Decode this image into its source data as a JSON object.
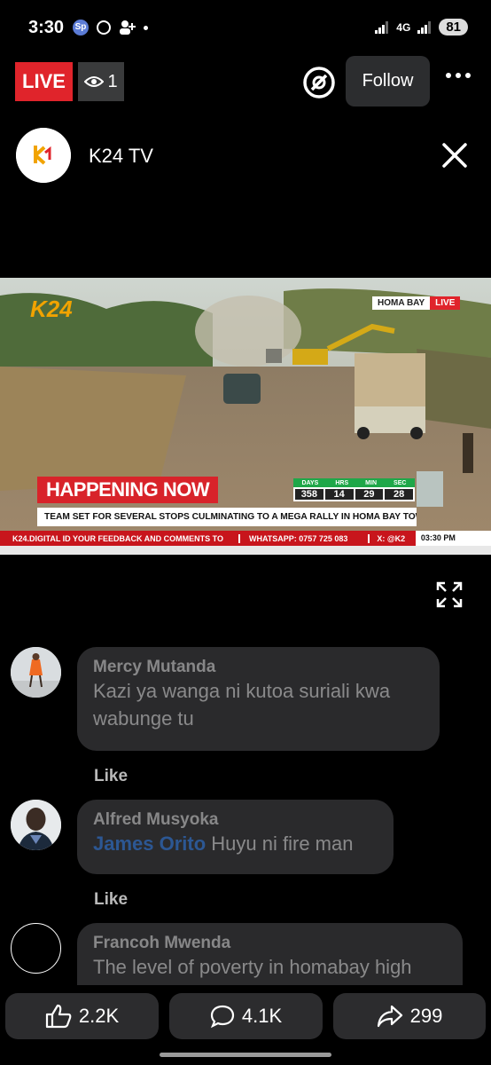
{
  "status_bar": {
    "time": "3:30",
    "network": "4G",
    "battery": "81"
  },
  "top_bar": {
    "live_label": "LIVE",
    "viewer_count": "1",
    "follow_label": "Follow"
  },
  "page": {
    "name": "K24 TV"
  },
  "video": {
    "channel_logo": "K24",
    "location": "HOMA BAY",
    "location_live": "LIVE",
    "headline": "HAPPENING NOW",
    "subheadline": "TEAM SET FOR SEVERAL STOPS CULMINATING TO A MEGA RALLY IN HOMA BAY TOWN",
    "countdown": {
      "labels": [
        "DAYS",
        "HRS",
        "MIN",
        "SEC"
      ],
      "values": [
        "358",
        "14",
        "29",
        "28"
      ]
    },
    "ticker": "K24.DIGITAL  ID YOUR FEEDBACK AND COMMENTS TO",
    "ticker_whatsapp": "WHATSAPP: 0757 725 083",
    "ticker_x": "X: @K2",
    "clock": "03:30 PM"
  },
  "comments": [
    {
      "author": "Mercy Mutanda",
      "line1": "Kazi ya wanga ni kutoa suriali kwa",
      "line2": "wabunge tu",
      "like": "Like"
    },
    {
      "author": "Alfred Musyoka",
      "mention": "James Orito",
      "text": " Huyu ni fire man",
      "like": "Like"
    },
    {
      "author": "Francoh Mwenda",
      "text": "The level of poverty in homabay high"
    }
  ],
  "actions": {
    "likes": "2.2K",
    "comments": "4.1K",
    "shares": "299"
  },
  "icons": [
    "eye-icon",
    "mention-icon",
    "more-icon",
    "close-icon",
    "expand-icon",
    "like-icon",
    "comment-icon",
    "share-icon"
  ]
}
